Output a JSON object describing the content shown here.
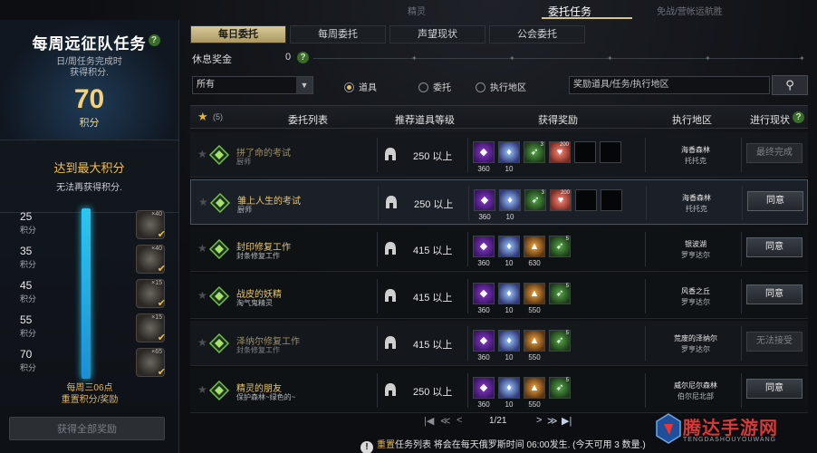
{
  "top_tabs": [
    {
      "label": "精灵",
      "active": false
    },
    {
      "label": "委托任务",
      "active": true
    },
    {
      "label": "免战/营帐运航胜",
      "active": false
    }
  ],
  "left_panel": {
    "title": "每周远征队任务",
    "subtitle_line1": "日/周任务完成时",
    "subtitle_line2": "获得积分.",
    "points": "70",
    "points_label": "积分",
    "max_title": "达到最大积分",
    "max_sub": "无法再获得积分.",
    "milestones": [
      {
        "value": "25",
        "label": "积分",
        "count": "×40"
      },
      {
        "value": "35",
        "label": "积分",
        "count": "×40"
      },
      {
        "value": "45",
        "label": "积分",
        "count": "×15"
      },
      {
        "value": "55",
        "label": "积分",
        "count": "×15"
      },
      {
        "value": "70",
        "label": "积分",
        "count": "×65"
      }
    ],
    "reset_line1": "每周三06点",
    "reset_line2": "重置积分/奖励",
    "claim_button": "获得全部奖励"
  },
  "sub_tabs": [
    {
      "label": "每日委托",
      "active": true
    },
    {
      "label": "每周委托",
      "active": false
    },
    {
      "label": "声望现状",
      "active": false
    },
    {
      "label": "公会委托",
      "active": false
    }
  ],
  "rest_bonus": {
    "label": "休息奖金",
    "value": "0"
  },
  "filter": {
    "select_value": "所有",
    "radios": [
      {
        "label": "道具",
        "selected": true
      },
      {
        "label": "委托",
        "selected": false
      },
      {
        "label": "执行地区",
        "selected": false
      }
    ],
    "search_placeholder": "奖励道具/任务/执行地区"
  },
  "table": {
    "favorite_count": "(5)",
    "headers": {
      "list": "委托列表",
      "level": "推荐道具等级",
      "reward": "获得奖励",
      "region": "执行地区",
      "status": "进行现状"
    },
    "rows": [
      {
        "name": "拼了命的考试",
        "giver": "厨师",
        "level": "250 以上",
        "rewards": [
          {
            "type": "purple",
            "count": "360"
          },
          {
            "type": "diamond",
            "count": "10"
          },
          {
            "type": "green",
            "count": "",
            "mini": "3"
          },
          {
            "type": "heart",
            "count": "",
            "mini": "200"
          },
          {
            "type": "empty",
            "count": ""
          },
          {
            "type": "empty",
            "count": ""
          }
        ],
        "loc1": "海香森林",
        "loc2": "托托克",
        "button": "最终完成",
        "state": "dim"
      },
      {
        "name": "雏上人生的考试",
        "giver": "厨师",
        "level": "250 以上",
        "rewards": [
          {
            "type": "purple",
            "count": "360"
          },
          {
            "type": "diamond",
            "count": "10"
          },
          {
            "type": "green",
            "count": "",
            "mini": "3"
          },
          {
            "type": "heart",
            "count": "",
            "mini": "200"
          },
          {
            "type": "empty",
            "count": ""
          },
          {
            "type": "empty",
            "count": ""
          }
        ],
        "loc1": "海香森林",
        "loc2": "托托克",
        "button": "同意",
        "state": "sel"
      },
      {
        "name": "封印修复工作",
        "giver": "封条修复工作",
        "level": "415 以上",
        "rewards": [
          {
            "type": "purple",
            "count": "360"
          },
          {
            "type": "diamond",
            "count": "10"
          },
          {
            "type": "amber",
            "count": "630"
          },
          {
            "type": "green",
            "count": "",
            "mini": "5"
          }
        ],
        "loc1": "银波湖",
        "loc2": "罗亨达尔",
        "button": "同意",
        "state": "normal"
      },
      {
        "name": "战皮的妖精",
        "giver": "淘气鬼精灵",
        "level": "415 以上",
        "rewards": [
          {
            "type": "purple",
            "count": "360"
          },
          {
            "type": "diamond",
            "count": "10"
          },
          {
            "type": "amber",
            "count": "550"
          },
          {
            "type": "green",
            "count": "",
            "mini": "5"
          }
        ],
        "loc1": "风香之丘",
        "loc2": "罗亨达尔",
        "button": "同意",
        "state": "normal"
      },
      {
        "name": "泽纳尔修复工作",
        "giver": "封条修复工作",
        "level": "415 以上",
        "rewards": [
          {
            "type": "purple",
            "count": "360"
          },
          {
            "type": "diamond",
            "count": "10"
          },
          {
            "type": "amber",
            "count": "550"
          },
          {
            "type": "green",
            "count": "",
            "mini": "5"
          }
        ],
        "loc1": "荒废的泽纳尔",
        "loc2": "罗亨达尔",
        "button": "无法接受",
        "state": "dim"
      },
      {
        "name": "精灵的朋友",
        "giver": "保护森林~绿色的~",
        "level": "250 以上",
        "rewards": [
          {
            "type": "purple",
            "count": "360"
          },
          {
            "type": "diamond",
            "count": "10"
          },
          {
            "type": "amber",
            "count": "550"
          },
          {
            "type": "green",
            "count": "",
            "mini": "5"
          }
        ],
        "loc1": "威尔尼尔森林",
        "loc2": "伯尔尼北部",
        "button": "同意",
        "state": "normal"
      }
    ]
  },
  "pager": {
    "first": "|◀",
    "prev": "≪",
    "prev_single": "<",
    "current": "1/21",
    "next_single": ">",
    "next": "≫",
    "last": "▶|"
  },
  "notice": {
    "prefix": "重置",
    "text": "任务列表 将会在每天俄罗斯时间 06:00发生. (今天可用 3 数量.)"
  },
  "watermark": {
    "text": "腾达手游网",
    "sub": "TENGDASHOUYOUWANG"
  },
  "colors": {
    "accent_gold": "#d8c99a",
    "progress_blue": "#2bc6f0",
    "title_gold": "#e9c66a"
  }
}
